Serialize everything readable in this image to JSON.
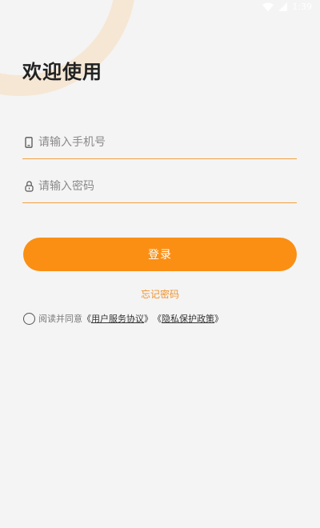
{
  "status_bar": {
    "time": "1:39",
    "icons": [
      "wifi-icon",
      "signal-icon"
    ]
  },
  "header": {
    "title": "欢迎使用"
  },
  "form": {
    "phone": {
      "placeholder": "请输入手机号",
      "icon": "phone-icon"
    },
    "password": {
      "placeholder": "请输入密码",
      "icon": "lock-icon"
    },
    "login_label": "登录",
    "forgot_label": "忘记密码"
  },
  "agreement": {
    "prefix": "阅读并同意",
    "open_bracket_1": "《",
    "user_agreement": "用户服务协议",
    "close_bracket_1": "》",
    "open_bracket_2": "《",
    "privacy_policy": "隐私保护政策",
    "close_bracket_2": "》"
  },
  "colors": {
    "accent": "#fa8f14",
    "accent_text": "#f0922c",
    "background": "#f4f4f4",
    "deco": "#f6e7d5"
  }
}
